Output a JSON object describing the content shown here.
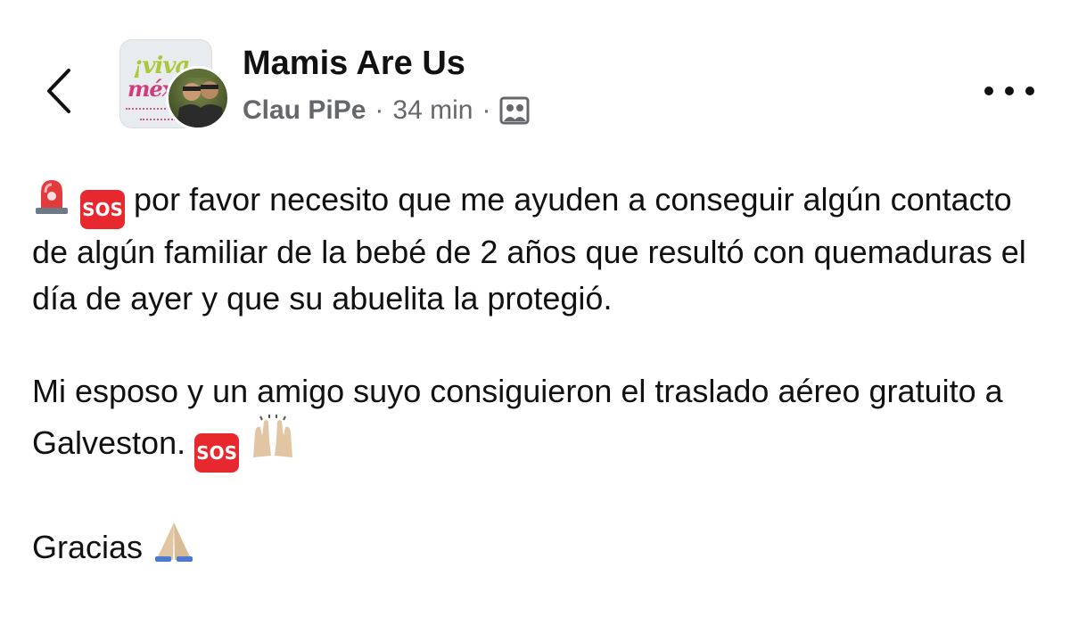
{
  "header": {
    "group_name": "Mamis Are Us",
    "author": "Clau PiPe",
    "separator": "·",
    "time": "34 min",
    "group_avatar": {
      "line1": "¡viva",
      "line2": "méx"
    },
    "privacy_icon": "group-privacy-icon"
  },
  "post": {
    "emoji_siren": "siren-emoji",
    "emoji_sos": "SOS",
    "para1_text": "por favor necesito que me ayuden a conseguir algún contacto de algún familiar de la bebé de 2 años que resultó con quemaduras el día de ayer y que su abuelita la protegió.",
    "para2_text": "Mi esposo y un amigo suyo consiguieron el traslado aéreo gratuito a Galveston.",
    "para3_text": "Gracias",
    "emoji_raising_hands": "raising-hands-emoji",
    "emoji_praying_hands": "praying-hands-emoji"
  },
  "colors": {
    "text": "#111111",
    "meta": "#65676b",
    "sos_red": "#e8282f"
  }
}
